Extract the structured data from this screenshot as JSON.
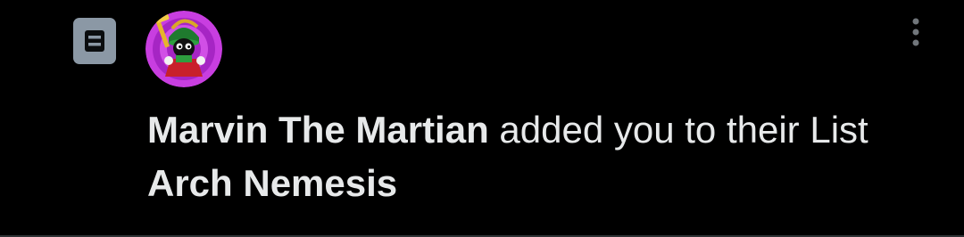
{
  "notification": {
    "icon": "list-icon",
    "avatar_icon": "marvin-the-martian-avatar",
    "more_icon": "vertical-ellipsis-icon",
    "actor_name": "Marvin The Martian",
    "action_text": " added you to their List ",
    "list_name": "Arch Nemesis",
    "colors": {
      "background": "#000000",
      "text": "#e7e9ea",
      "badge": "#8b98a5",
      "divider": "#2f3336",
      "avatar_ring": "#c83ee0"
    }
  }
}
